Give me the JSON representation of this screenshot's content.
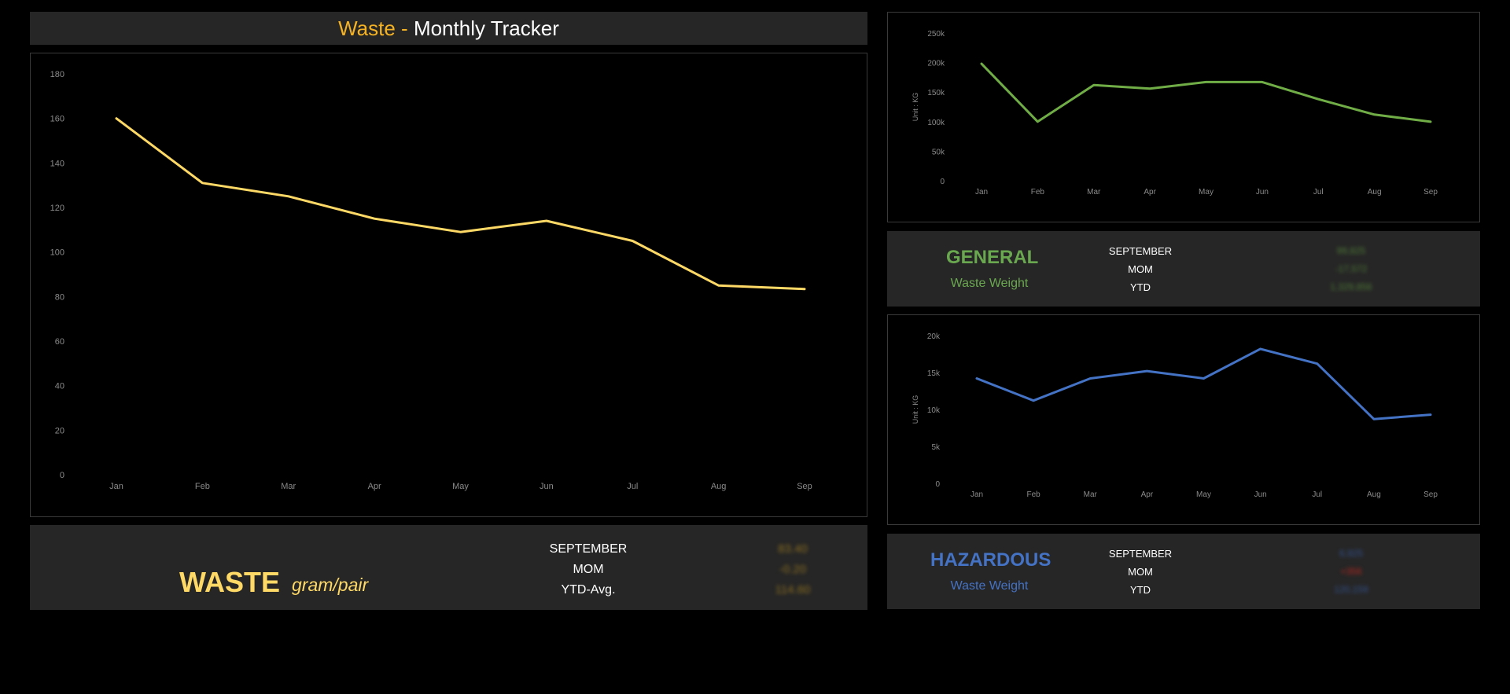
{
  "header": {
    "title_accent": "Waste -",
    "title_main": "Monthly Tracker"
  },
  "colors": {
    "waste": "#ffd966",
    "general": "#70ad47",
    "hazardous": "#4472c4",
    "panel_bg": "#262626"
  },
  "chart_data": [
    {
      "type": "line",
      "title": "",
      "x": [
        "Jan",
        "Feb",
        "Mar",
        "Apr",
        "May",
        "Jun",
        "Jul",
        "Aug",
        "Sep"
      ],
      "series": [
        {
          "values": [
            160,
            131,
            125,
            115,
            109,
            114,
            105,
            85,
            83.4
          ]
        }
      ],
      "yticks": [
        "180",
        "160",
        "140",
        "120",
        "100",
        "80",
        "60",
        "40",
        "20",
        "0"
      ],
      "ylim": [
        0,
        180
      ],
      "ylabel": "",
      "grid": false
    },
    {
      "type": "line",
      "title": "",
      "x": [
        "Jan",
        "Feb",
        "Mar",
        "Apr",
        "May",
        "Jun",
        "Jul",
        "Aug",
        "Sep"
      ],
      "series": [
        {
          "values": [
            198000,
            100000,
            162000,
            156000,
            167000,
            167000,
            138000,
            112000,
            99825
          ]
        }
      ],
      "yticks": [
        "250k",
        "200k",
        "150k",
        "100k",
        "50k",
        "0"
      ],
      "ylim": [
        0,
        250000
      ],
      "ylabel": "Unit : KG",
      "grid": false
    },
    {
      "type": "line",
      "title": "",
      "x": [
        "Jan",
        "Feb",
        "Mar",
        "Apr",
        "May",
        "Jun",
        "Jul",
        "Aug",
        "Sep"
      ],
      "series": [
        {
          "values": [
            14200,
            11200,
            14200,
            15200,
            14200,
            18200,
            16200,
            8700,
            9300
          ]
        }
      ],
      "yticks": [
        "20k",
        "15k",
        "10k",
        "5k",
        "0"
      ],
      "ylim": [
        0,
        20000
      ],
      "ylabel": "Unit : KG",
      "grid": false
    }
  ],
  "waste_summary": {
    "title": "WASTE",
    "unit": "gram/pair",
    "labels": [
      "SEPTEMBER",
      "MOM",
      "YTD-Avg."
    ],
    "values": [
      "83.40",
      "-0.20",
      "114.60"
    ]
  },
  "general_summary": {
    "title": "GENERAL",
    "subtitle": "Waste Weight",
    "labels": [
      "SEPTEMBER",
      "MOM",
      "YTD"
    ],
    "values": [
      "99,825",
      "-17,572",
      "1,329,856"
    ]
  },
  "hazard_summary": {
    "title": "HAZARDOUS",
    "subtitle": "Waste Weight",
    "labels": [
      "SEPTEMBER",
      "MOM",
      "YTD"
    ],
    "values": [
      "6,925",
      "+356",
      "120,159"
    ]
  }
}
